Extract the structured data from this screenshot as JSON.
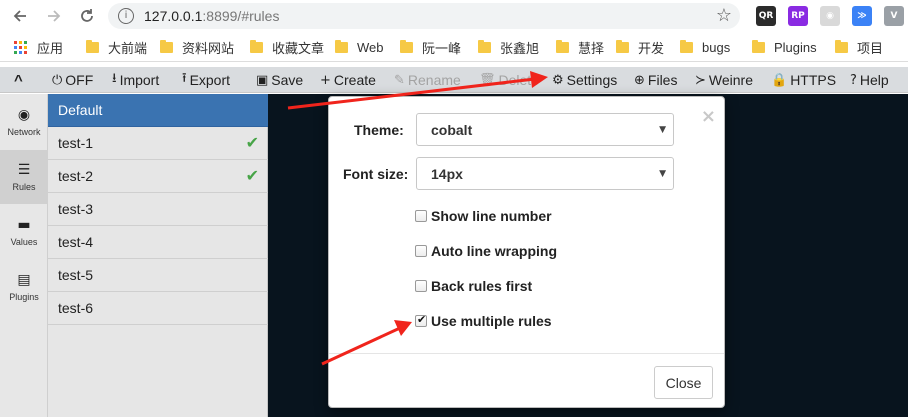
{
  "browser": {
    "url_host": "127.0.0.1",
    "url_rest": ":8899/#rules",
    "info_glyph": "i",
    "star_glyph": "☆",
    "extensions": [
      {
        "name": "qr-extension-icon",
        "label": "QR",
        "color": "#2b2b2b"
      },
      {
        "name": "rp-extension-icon",
        "label": "RP",
        "color": "#8a2be2"
      },
      {
        "name": "camera-extension-icon",
        "label": "◉",
        "color": "#d9d9d9"
      },
      {
        "name": "chevrons-extension-icon",
        "label": "≫",
        "color": "#3b82f6"
      },
      {
        "name": "vue-extension-icon",
        "label": "V",
        "color": "#9aa0a6"
      }
    ]
  },
  "bookmarks": [
    {
      "label": "应用",
      "type": "apps"
    },
    {
      "label": "大前端",
      "type": "folder"
    },
    {
      "label": "资料网站",
      "type": "folder"
    },
    {
      "label": "收藏文章",
      "type": "folder"
    },
    {
      "label": "Web",
      "type": "folder"
    },
    {
      "label": "阮一峰",
      "type": "folder"
    },
    {
      "label": "张鑫旭",
      "type": "folder"
    },
    {
      "label": "慧择",
      "type": "folder"
    },
    {
      "label": "开发",
      "type": "folder"
    },
    {
      "label": "bugs",
      "type": "folder"
    },
    {
      "label": "Plugins",
      "type": "folder"
    },
    {
      "label": "项目",
      "type": "folder"
    }
  ],
  "toolbar": {
    "collapse": "^",
    "items": [
      {
        "name": "off-button",
        "icon": "⏻",
        "label": "OFF",
        "enabled": true
      },
      {
        "name": "import-button",
        "icon": "⭳",
        "label": "Import",
        "enabled": true
      },
      {
        "name": "export-button",
        "icon": "⭱",
        "label": "Export",
        "enabled": true
      },
      {
        "name": "save-button",
        "icon": "▣",
        "label": "Save",
        "enabled": true
      },
      {
        "name": "create-button",
        "icon": "+",
        "label": "Create",
        "enabled": true
      },
      {
        "name": "rename-button",
        "icon": "✎",
        "label": "Rename",
        "enabled": false
      },
      {
        "name": "delete-button",
        "icon": "🗑",
        "label": "Delete",
        "enabled": false
      },
      {
        "name": "settings-button",
        "icon": "⚙",
        "label": "Settings",
        "enabled": true
      },
      {
        "name": "files-button",
        "icon": "⊕",
        "label": "Files",
        "enabled": true
      },
      {
        "name": "weinre-button",
        "icon": "≻",
        "label": "Weinre",
        "enabled": true
      },
      {
        "name": "https-button",
        "icon": "🔒",
        "label": "HTTPS",
        "enabled": true
      },
      {
        "name": "help-button",
        "icon": "?",
        "label": "Help",
        "enabled": true
      }
    ]
  },
  "leftnav": [
    {
      "name": "nav-network",
      "icon": "◉",
      "label": "Network",
      "active": false
    },
    {
      "name": "nav-rules",
      "icon": "☰",
      "label": "Rules",
      "active": true
    },
    {
      "name": "nav-values",
      "icon": "▬",
      "label": "Values",
      "active": false
    },
    {
      "name": "nav-plugins",
      "icon": "▤",
      "label": "Plugins",
      "active": false
    }
  ],
  "rules": [
    {
      "label": "Default",
      "selected": true,
      "active": false
    },
    {
      "label": "test-1",
      "selected": false,
      "active": true
    },
    {
      "label": "test-2",
      "selected": false,
      "active": true
    },
    {
      "label": "test-3",
      "selected": false,
      "active": false
    },
    {
      "label": "test-4",
      "selected": false,
      "active": false
    },
    {
      "label": "test-5",
      "selected": false,
      "active": false
    },
    {
      "label": "test-6",
      "selected": false,
      "active": false
    }
  ],
  "check_glyph": "✔",
  "settings_dialog": {
    "close_glyph": "×",
    "theme_label": "Theme:",
    "theme_value": "cobalt",
    "font_size_label": "Font size:",
    "font_size_value": "14px",
    "caret_glyph": "▼",
    "options": [
      {
        "name": "show-line-number",
        "label": "Show line number",
        "checked": false
      },
      {
        "name": "auto-line-wrapping",
        "label": "Auto line wrapping",
        "checked": false
      },
      {
        "name": "back-rules-first",
        "label": "Back rules first",
        "checked": false
      },
      {
        "name": "use-multiple-rules",
        "label": "Use multiple rules",
        "checked": true
      }
    ],
    "close_button": "Close"
  },
  "colors": {
    "selected_rule": "#3a73b1",
    "editor_bg": "#0d1f2e",
    "annotation_arrow": "#f0241c",
    "active_check": "#47a447"
  }
}
